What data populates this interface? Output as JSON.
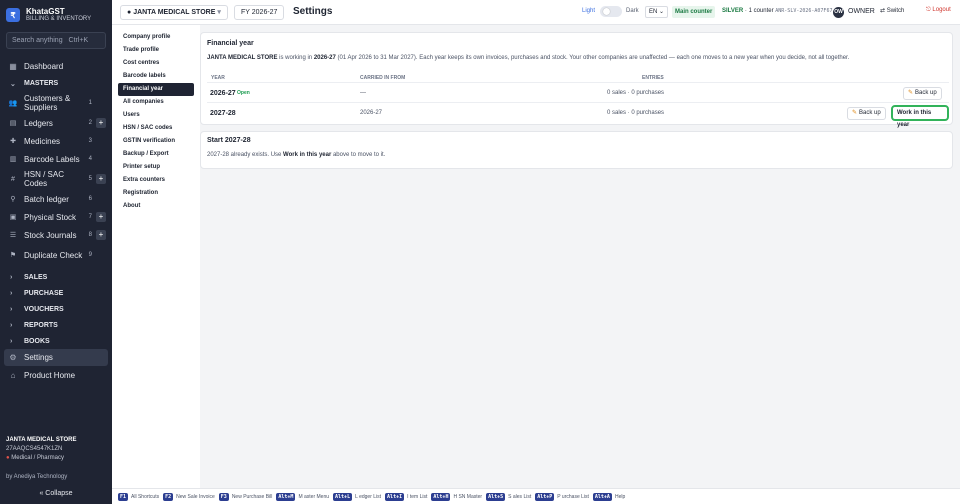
{
  "brand": {
    "logo": "₹",
    "name": "KhataGST",
    "sub": "BILLING & INVENTORY"
  },
  "search": {
    "placeholder": "Search anything",
    "shortcut": "Ctrl+K"
  },
  "nav": {
    "dashboard": "Dashboard",
    "masters": "MASTERS",
    "items": [
      {
        "label": "Customers & Suppliers",
        "count": "1",
        "plus": false,
        "icon": "users-icon"
      },
      {
        "label": "Ledgers",
        "count": "2",
        "plus": true,
        "icon": "ledger-icon"
      },
      {
        "label": "Medicines",
        "count": "3",
        "plus": false,
        "icon": "pill-icon"
      },
      {
        "label": "Barcode Labels",
        "count": "4",
        "plus": false,
        "icon": "barcode-icon"
      },
      {
        "label": "HSN / SAC Codes",
        "count": "5",
        "plus": true,
        "icon": "tag-icon"
      },
      {
        "label": "Batch ledger",
        "count": "6",
        "plus": false,
        "icon": "batch-icon"
      },
      {
        "label": "Physical Stock",
        "count": "7",
        "plus": true,
        "icon": "box-icon"
      },
      {
        "label": "Stock Journals",
        "count": "8",
        "plus": true,
        "icon": "journal-icon"
      },
      {
        "label": "Duplicate Check",
        "count": "9",
        "plus": false,
        "icon": "check-icon"
      }
    ],
    "sections": [
      "SALES",
      "PURCHASE",
      "VOUCHERS",
      "REPORTS",
      "BOOKS"
    ],
    "settings": "Settings",
    "product_home": "Product Home"
  },
  "footer": {
    "company": "JANTA MEDICAL STORE",
    "gstin": "27AAQCS4547K1ZN",
    "type": "Medical / Pharmacy",
    "by": "by Anediya Technology",
    "collapse": "« Collapse"
  },
  "topbar": {
    "company": "JANTA MEDICAL STORE",
    "fy": "FY 2026-27",
    "title": "Settings",
    "light": "Light",
    "dark": "Dark",
    "lang": "EN",
    "main_counter": "Main counter",
    "license_tier": "SILVER",
    "license_counter": "· 1 counter",
    "license_code": "ANR-SLV-2026-A07F67",
    "owner_initials": "OW",
    "owner": "OWNER",
    "switch": "Switch",
    "logout": "Logout"
  },
  "subnav": [
    "Company profile",
    "Trade profile",
    "Cost centres",
    "Barcode labels",
    "Financial year",
    "All companies",
    "Users",
    "HSN / SAC codes",
    "GSTIN verification",
    "Backup / Export",
    "Printer setup",
    "Extra counters",
    "Registration",
    "About"
  ],
  "financial_year": {
    "title": "Financial year",
    "desc_company": "JANTA MEDICAL STORE",
    "desc_mid": " is working in ",
    "desc_fy": "2026-27",
    "desc_rest": " (01 Apr 2026 to 31 Mar 2027). Each year keeps its own invoices, purchases and stock. Your other companies are unaffected — each one moves to a new year when you decide, not all together.",
    "headers": {
      "year": "YEAR",
      "carried": "CARRIED IN FROM",
      "entries": "ENTRIES"
    },
    "rows": [
      {
        "year": "2026-27",
        "badge": "Open",
        "carried": "—",
        "entries": "0 sales · 0 purchases",
        "backup": "Back up"
      },
      {
        "year": "2027-28",
        "badge": "",
        "carried": "2026-27",
        "entries": "0 sales · 0 purchases",
        "backup": "Back up",
        "work": "Work in this year"
      }
    ]
  },
  "start": {
    "title": "Start 2027-28",
    "desc_a": "2027-28 already exists. Use ",
    "desc_b": "Work in this year",
    "desc_c": " above to move to it."
  },
  "shortcuts": [
    {
      "key": "F1",
      "label": "All Shortcuts"
    },
    {
      "key": "F2",
      "label": "New Sale Invoice"
    },
    {
      "key": "F3",
      "label": "New Purchase Bill"
    },
    {
      "key": "Alt+M",
      "label": "M aster Menu"
    },
    {
      "key": "Alt+L",
      "label": "L edger List"
    },
    {
      "key": "Alt+I",
      "label": "I tem List"
    },
    {
      "key": "Alt+H",
      "label": "H SN Master"
    },
    {
      "key": "Alt+S",
      "label": "S ales List"
    },
    {
      "key": "Alt+P",
      "label": "P urchase List"
    },
    {
      "key": "Alt+A",
      "label": "Help"
    }
  ]
}
